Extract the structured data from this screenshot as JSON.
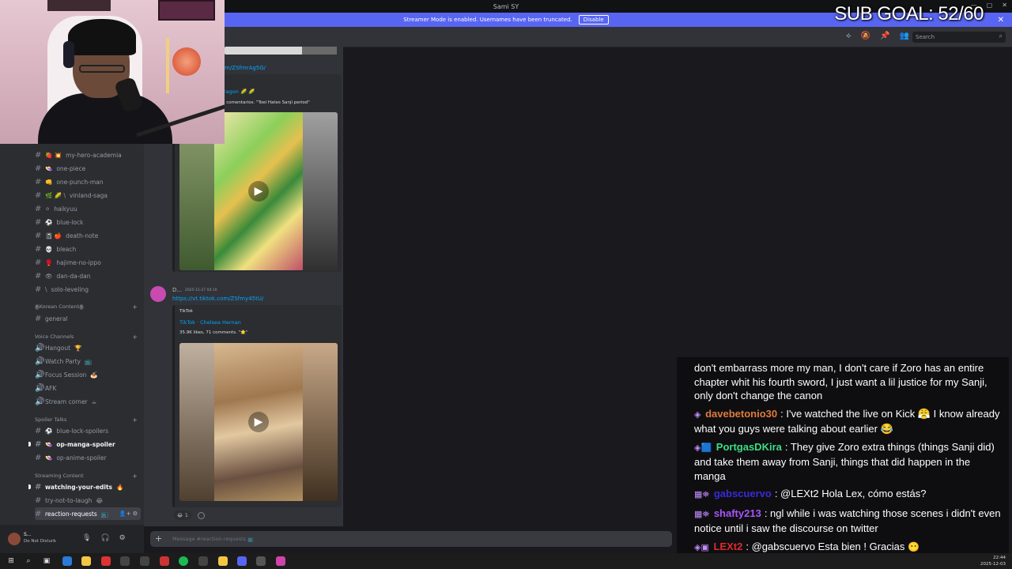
{
  "window": {
    "title": "Sami SY",
    "controls": [
      "—",
      "▢",
      "✕"
    ]
  },
  "banner": {
    "text": "Streamer Mode is enabled. Usernames have been truncated.",
    "button": "Disable",
    "close": "✕"
  },
  "overlay": {
    "sub_goal": "SUB GOAL: 52/60"
  },
  "toolbar": {
    "search_placeholder": "Search",
    "icons": [
      "threads-icon",
      "mute-icon",
      "pin-icon",
      "members-icon"
    ]
  },
  "sidebar": {
    "channels": [
      {
        "prefix": "🍓 💥",
        "name": "my-hero-academia"
      },
      {
        "prefix": "👒",
        "name": "one-piece"
      },
      {
        "prefix": "👊",
        "name": "one-punch-man"
      },
      {
        "prefix": "🌿 🌽 \\",
        "name": "vinland-saga"
      },
      {
        "prefix": "⚪",
        "name": "haikyuu"
      },
      {
        "prefix": "⚽",
        "name": "blue-lock"
      },
      {
        "prefix": "📓 🍎",
        "name": "death-note"
      },
      {
        "prefix": "💀",
        "name": "bleach"
      },
      {
        "prefix": "🥊",
        "name": "hajime-no-ippo"
      },
      {
        "prefix": "👁",
        "name": "dan-da-dan"
      },
      {
        "prefix": "\\",
        "name": "solo-leveling"
      }
    ],
    "categories": {
      "korean": "ꙮKorean Contentꙮ",
      "voice": "Voice Channels",
      "spoiler": "Spoiler Talks",
      "streaming": "Streaming Content"
    },
    "general": "general",
    "voice_channels": [
      {
        "name": "Hangout",
        "emoji": "🏆"
      },
      {
        "name": "Watch Party",
        "emoji": "📺"
      },
      {
        "name": "Focus Session",
        "emoji": "🍝"
      },
      {
        "name": "AFK",
        "emoji": ""
      },
      {
        "name": "Stream corner",
        "emoji": "☕"
      }
    ],
    "spoiler_channels": [
      {
        "prefix": "⚽",
        "name": "blue-lock-spoilers",
        "unread": false
      },
      {
        "prefix": "👒",
        "name": "op-manga-spoiler",
        "unread": true
      },
      {
        "prefix": "👒",
        "name": "op-anime-spoiler",
        "unread": false
      }
    ],
    "streaming_channels": [
      {
        "name": "watching-your-edits",
        "emoji": "🔥",
        "unread": true
      },
      {
        "name": "try-not-to-laugh",
        "emoji": "😂",
        "unread": false
      },
      {
        "name": "reaction-requests",
        "emoji": "📺",
        "active": true
      }
    ],
    "active_actions": "👤+ ⚙"
  },
  "user": {
    "name": "S...",
    "status": "Do Not Disturb"
  },
  "messages": {
    "top_link": "m/ZSfmrAg5G/",
    "embed1": {
      "author": "ragon 🌽 🌽",
      "desc": "l comentarios. \"Toei Hates Sanji period\""
    },
    "msg2": {
      "name": "D...",
      "time": "2025-11-27 04:10",
      "link": "https://vt.tiktok.com/ZSfmy45tU/"
    },
    "embed2": {
      "provider": "TikTok",
      "author": "TikTok · Chelsea Hernan",
      "desc": "35.9K likes, 71 comments. \"🌟\""
    },
    "reaction": {
      "emoji": "😂",
      "count": "1"
    }
  },
  "input": {
    "placeholder": "Message #reaction-requests 📺"
  },
  "chat": [
    {
      "badge": "",
      "user": "",
      "color": "#ffffff",
      "text": "don't embarrass more my man, I don't care if Zoro has an entire chapter whit his fourth sword, I just want a lil justice for my Sanji, only don't change the canon"
    },
    {
      "badge": "◈",
      "user": "davebetonio30",
      "color": "#e07a3a",
      "text": "I've watched the live on Kick 😤 I know already what you guys were talking about earlier 😂"
    },
    {
      "badge": "◈🟦",
      "user": "PortgasDKira",
      "color": "#3ddc84",
      "text": "They give Zoro extra things (things Sanji did) and take them away from Sanji, things that did happen in the manga"
    },
    {
      "badge": "▦⛯",
      "user": "gabscuervo",
      "color": "#3a2ad9",
      "text": "@LEXt2 Hola Lex, cómo estás?"
    },
    {
      "badge": "▦⛯",
      "user": "shafty213",
      "color": "#a855f7",
      "text": "ngl while i was watching those scenes i didn't even notice until i saw the discourse on twitter"
    },
    {
      "badge": "◈▣",
      "user": "LEXt2",
      "color": "#e02a2a",
      "text": "@gabscuervo Esta bien ! Gracias"
    }
  ],
  "taskbar": {
    "time": "22:44",
    "date": "2025-12-03"
  }
}
